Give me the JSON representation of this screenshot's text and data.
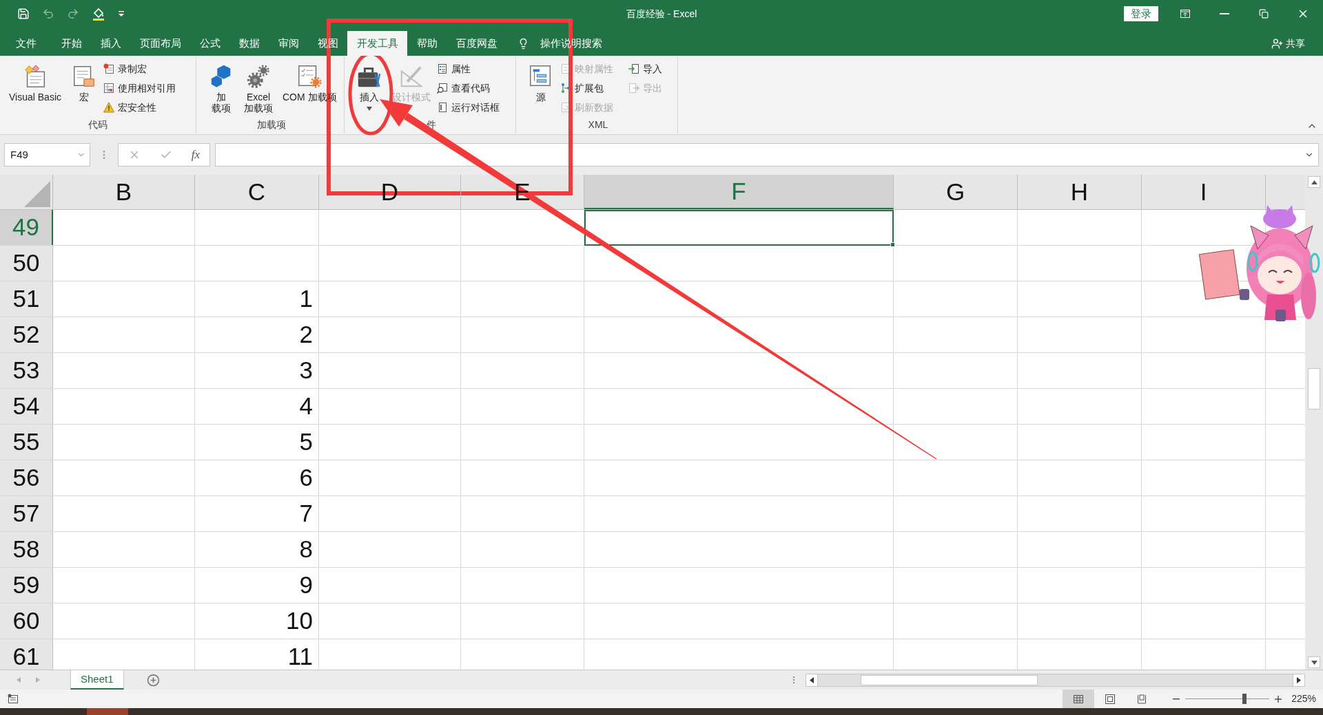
{
  "title_bar": {
    "title": "百度经验 - Excel",
    "sign_in": "登录"
  },
  "quick_access": [
    {
      "kind": "save",
      "disabled": false
    },
    {
      "kind": "undo",
      "disabled": true
    },
    {
      "kind": "redo",
      "disabled": true
    },
    {
      "kind": "fill_color",
      "disabled": false
    },
    {
      "kind": "customize",
      "disabled": false
    }
  ],
  "tabs": [
    {
      "label": "文件",
      "selected": false
    },
    {
      "label": "开始",
      "selected": false
    },
    {
      "label": "插入",
      "selected": false
    },
    {
      "label": "页面布局",
      "selected": false
    },
    {
      "label": "公式",
      "selected": false
    },
    {
      "label": "数据",
      "selected": false
    },
    {
      "label": "审阅",
      "selected": false
    },
    {
      "label": "视图",
      "selected": false
    },
    {
      "label": "开发工具",
      "selected": true
    },
    {
      "label": "帮助",
      "selected": false
    },
    {
      "label": "百度网盘",
      "selected": false
    }
  ],
  "tell_me": "操作说明搜索",
  "share": "共享",
  "ribbon": {
    "groups": [
      {
        "label": "代码",
        "items": [
          {
            "kind": "large",
            "lines": [
              "Visual Basic"
            ],
            "disabled": false
          },
          {
            "kind": "large",
            "lines": [
              "宏"
            ],
            "disabled": false
          },
          {
            "kind": "small",
            "label": "录制宏",
            "disabled": false
          },
          {
            "kind": "small",
            "label": "使用相对引用",
            "disabled": false
          },
          {
            "kind": "small",
            "label": "宏安全性",
            "disabled": false
          }
        ]
      },
      {
        "label": "加载项",
        "items": [
          {
            "kind": "large",
            "lines": [
              "加",
              "载项"
            ],
            "disabled": false
          },
          {
            "kind": "large",
            "lines": [
              "Excel",
              "加载项"
            ],
            "disabled": false
          },
          {
            "kind": "large",
            "lines": [
              "COM 加载项"
            ],
            "disabled": false
          }
        ]
      },
      {
        "label": "件",
        "items": [
          {
            "kind": "large_dropdown",
            "lines": [
              "插入"
            ],
            "disabled": false
          },
          {
            "kind": "large",
            "lines": [
              "设计模式"
            ],
            "disabled": true
          },
          {
            "kind": "small",
            "label": "属性",
            "disabled": false
          },
          {
            "kind": "small",
            "label": "查看代码",
            "disabled": false
          },
          {
            "kind": "small",
            "label": "运行对话框",
            "disabled": false
          }
        ]
      },
      {
        "label": "XML",
        "items": [
          {
            "kind": "large",
            "lines": [
              "源"
            ],
            "disabled": false
          },
          {
            "kind": "small",
            "label": "映射属性",
            "disabled": true
          },
          {
            "kind": "small",
            "label": "扩展包",
            "disabled": false
          },
          {
            "kind": "small",
            "label": "刷新数据",
            "disabled": true
          },
          {
            "kind": "small",
            "label": "导入",
            "disabled": false
          },
          {
            "kind": "small",
            "label": "导出",
            "disabled": true
          }
        ]
      }
    ]
  },
  "formula_bar": {
    "name_box": "F49",
    "function_label": "fx"
  },
  "grid": {
    "columns": [
      {
        "label": "B",
        "selected": false
      },
      {
        "label": "C",
        "selected": false
      },
      {
        "label": "D",
        "selected": false
      },
      {
        "label": "E",
        "selected": false
      },
      {
        "label": "F",
        "selected": true
      },
      {
        "label": "G",
        "selected": false
      },
      {
        "label": "H",
        "selected": false
      },
      {
        "label": "I",
        "selected": false
      }
    ],
    "rows": [
      {
        "number": "49",
        "selected": true
      },
      {
        "number": "50",
        "selected": false
      },
      {
        "number": "51",
        "selected": false,
        "column_c": "1"
      },
      {
        "number": "52",
        "selected": false,
        "column_c": "2"
      },
      {
        "number": "53",
        "selected": false,
        "column_c": "3"
      },
      {
        "number": "54",
        "selected": false,
        "column_c": "4"
      },
      {
        "number": "55",
        "selected": false,
        "column_c": "5"
      },
      {
        "number": "56",
        "selected": false,
        "column_c": "6"
      },
      {
        "number": "57",
        "selected": false,
        "column_c": "7"
      },
      {
        "number": "58",
        "selected": false,
        "column_c": "8"
      },
      {
        "number": "59",
        "selected": false,
        "column_c": "9"
      },
      {
        "number": "60",
        "selected": false,
        "column_c": "10"
      },
      {
        "number": "61",
        "selected": false,
        "column_c": "11"
      }
    ]
  },
  "sheet_tabs": [
    {
      "label": "Sheet1",
      "selected": true
    }
  ],
  "status_bar": {
    "views": [
      {
        "kind": "normal",
        "selected": true
      },
      {
        "kind": "page_layout",
        "selected": false
      },
      {
        "kind": "page_break",
        "selected": false
      }
    ],
    "zoom": {
      "level": 0.7,
      "reading": "225%"
    }
  },
  "taskbar": {
    "items": [
      {
        "selected": true
      }
    ]
  },
  "annotations": [
    {
      "kind": "rectangle"
    },
    {
      "kind": "ellipse"
    },
    {
      "kind": "arrow"
    }
  ],
  "sticker": {
    "kind": "mascot"
  }
}
